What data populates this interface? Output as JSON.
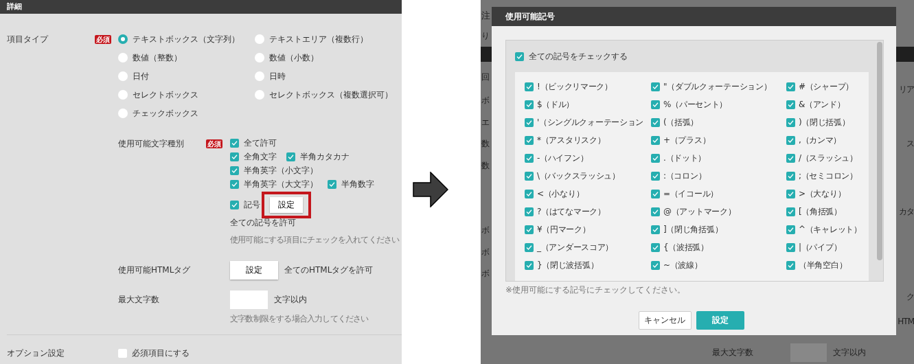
{
  "left_screen": {
    "header": "詳細",
    "item_type": {
      "label": "項目タイプ",
      "badge": "必須",
      "options": [
        {
          "label": "テキストボックス（文字列）",
          "selected": true
        },
        {
          "label": "テキストエリア（複数行）",
          "selected": false
        },
        {
          "label": "数値（整数）",
          "selected": false
        },
        {
          "label": "数値（小数）",
          "selected": false
        },
        {
          "label": "日付",
          "selected": false
        },
        {
          "label": "日時",
          "selected": false
        },
        {
          "label": "セレクトボックス",
          "selected": false
        },
        {
          "label": "セレクトボックス（複数選択可）",
          "selected": false
        },
        {
          "label": "チェックボックス",
          "selected": false
        }
      ]
    },
    "char_types": {
      "label": "使用可能文字種別",
      "badge": "必須",
      "rows": [
        [
          {
            "label": "全て許可",
            "checked": true
          }
        ],
        [
          {
            "label": "全角文字",
            "checked": true
          },
          {
            "label": "半角カタカナ",
            "checked": true
          }
        ],
        [
          {
            "label": "半角英字（小文字）",
            "checked": true
          }
        ],
        [
          {
            "label": "半角英字（大文字）",
            "checked": true
          },
          {
            "label": "半角数字",
            "checked": true
          }
        ],
        [
          {
            "label": "記号",
            "checked": true
          }
        ]
      ],
      "button": {
        "label": "設定",
        "highlighted": true
      },
      "status": "全ての記号を許可",
      "hint": "使用可能にする項目にチェックを入れてください"
    },
    "html_tags": {
      "label": "使用可能HTMLタグ",
      "button": "設定",
      "status": "全てのHTMLタグを許可"
    },
    "max_chars": {
      "label": "最大文字数",
      "suffix": "文字以内",
      "hint": "文字数制限をする場合入力してください"
    },
    "options": {
      "label": "オプション設定",
      "checkbox": {
        "label": "必須項目にする",
        "checked": false
      }
    }
  },
  "right_screen": {
    "backdrop": {
      "left_edge": [
        "注",
        "り",
        "回",
        "ボ",
        "エ",
        "数",
        "数",
        "ボ",
        "ボ",
        "ボ"
      ],
      "right_edge": [
        "リア",
        "ス",
        "カタ",
        "ク",
        "HTM"
      ],
      "max_chars_label": "最大文字数",
      "max_chars_suffix": "文字以内"
    },
    "dialog": {
      "title": "使用可能記号",
      "check_all": {
        "label": "全ての記号をチェックする",
        "checked": true
      },
      "symbols": [
        {
          "label": "!（ビックリマーク）",
          "checked": true
        },
        {
          "label": "\"（ダブルクォーテーション）",
          "checked": true
        },
        {
          "label": "#（シャープ）",
          "checked": true
        },
        {
          "label": "$（ドル）",
          "checked": true
        },
        {
          "label": "%（パーセント）",
          "checked": true
        },
        {
          "label": "&（アンド）",
          "checked": true
        },
        {
          "label": "'（シングルクォーテーション",
          "checked": true
        },
        {
          "label": "(（括弧）",
          "checked": true
        },
        {
          "label": ")（閉じ括弧）",
          "checked": true
        },
        {
          "label": "*（アスタリスク）",
          "checked": true
        },
        {
          "label": "+（プラス）",
          "checked": true
        },
        {
          "label": ",（カンマ）",
          "checked": true
        },
        {
          "label": "-（ハイフン）",
          "checked": true
        },
        {
          "label": ".（ドット）",
          "checked": true
        },
        {
          "label": "/（スラッシュ）",
          "checked": true
        },
        {
          "label": "\\（バックスラッシュ）",
          "checked": true
        },
        {
          "label": ":（コロン）",
          "checked": true
        },
        {
          "label": ";（セミコロン）",
          "checked": true
        },
        {
          "label": "<（小なり）",
          "checked": true
        },
        {
          "label": "=（イコール）",
          "checked": true
        },
        {
          "label": ">（大なり）",
          "checked": true
        },
        {
          "label": "?（はてなマーク）",
          "checked": true
        },
        {
          "label": "@（アットマーク）",
          "checked": true
        },
        {
          "label": "[（角括弧）",
          "checked": true
        },
        {
          "label": "¥（円マーク）",
          "checked": true
        },
        {
          "label": "]（閉じ角括弧）",
          "checked": true
        },
        {
          "label": "^（キャレット）",
          "checked": true
        },
        {
          "label": "_（アンダースコア）",
          "checked": true
        },
        {
          "label": "{（波括弧）",
          "checked": true
        },
        {
          "label": "|（パイプ）",
          "checked": true
        },
        {
          "label": "}（閉じ波括弧）",
          "checked": true
        },
        {
          "label": "~（波線）",
          "checked": true
        },
        {
          "label": "（半角空白）",
          "checked": true
        }
      ],
      "note": "※使用可能にする記号にチェックしてください。",
      "buttons": [
        {
          "label": "キャンセル",
          "kind": "secondary"
        },
        {
          "label": "設定",
          "kind": "primary"
        }
      ]
    }
  }
}
